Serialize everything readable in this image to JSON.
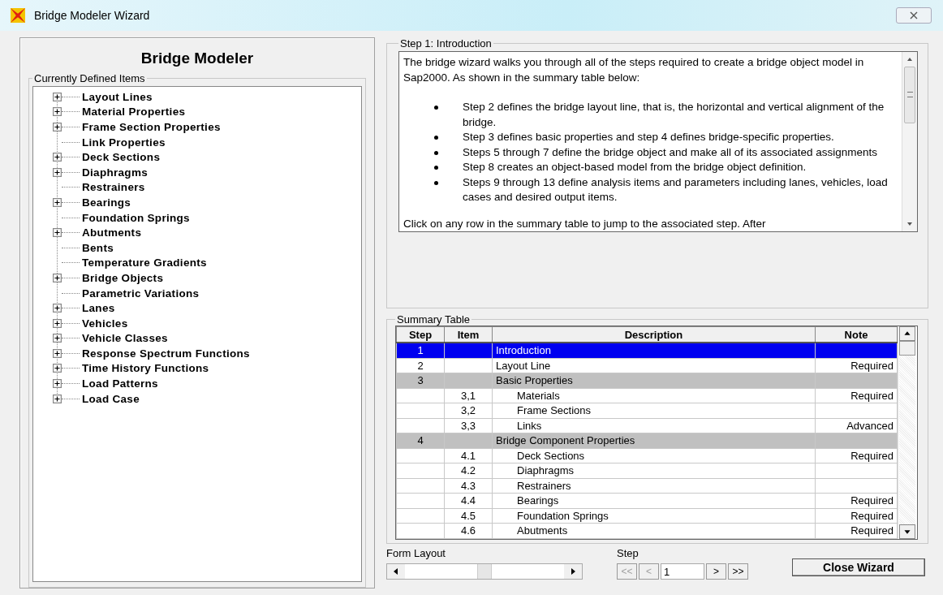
{
  "window": {
    "title": "Bridge Modeler Wizard"
  },
  "heading": "Bridge Modeler",
  "tree": {
    "label": "Currently Defined Items",
    "items": [
      {
        "label": "Layout Lines",
        "has_children": true
      },
      {
        "label": "Material Properties",
        "has_children": true
      },
      {
        "label": "Frame Section Properties",
        "has_children": true
      },
      {
        "label": "Link Properties",
        "has_children": false
      },
      {
        "label": "Deck Sections",
        "has_children": true
      },
      {
        "label": "Diaphragms",
        "has_children": true
      },
      {
        "label": "Restrainers",
        "has_children": false
      },
      {
        "label": "Bearings",
        "has_children": true
      },
      {
        "label": "Foundation Springs",
        "has_children": false
      },
      {
        "label": "Abutments",
        "has_children": true
      },
      {
        "label": "Bents",
        "has_children": false
      },
      {
        "label": "Temperature Gradients",
        "has_children": false
      },
      {
        "label": "Bridge Objects",
        "has_children": true
      },
      {
        "label": "Parametric Variations",
        "has_children": false
      },
      {
        "label": "Lanes",
        "has_children": true
      },
      {
        "label": "Vehicles",
        "has_children": true
      },
      {
        "label": "Vehicle Classes",
        "has_children": true
      },
      {
        "label": "Response Spectrum Functions",
        "has_children": true
      },
      {
        "label": "Time History Functions",
        "has_children": true
      },
      {
        "label": "Load Patterns",
        "has_children": true
      },
      {
        "label": "Load Case",
        "has_children": true
      }
    ]
  },
  "step_panel": {
    "label": "Step 1:  Introduction",
    "intro": "The bridge wizard walks you through all of the steps required to create a bridge object model in Sap2000. As shown in the summary table below:",
    "bullets": [
      "Step 2 defines the bridge layout line, that is, the horizontal and vertical alignment of the bridge.",
      "Step 3 defines basic properties and step 4 defines bridge-specific properties.",
      "Steps 5 through 7 define the bridge object and make all of its associated assignments",
      "Step 8 creates an object-based model from the bridge object definition.",
      "Steps 9 through 13 define analysis items and parameters including lanes, vehicles, load cases and desired output items."
    ],
    "outro": "Click on any row in the summary table to jump to the associated step. After"
  },
  "summary": {
    "label": "Summary Table",
    "columns": [
      "Step",
      "Item",
      "Description",
      "Note"
    ],
    "rows": [
      {
        "kind": "step",
        "step": "1",
        "item": "",
        "description": "Introduction",
        "note": "",
        "selected": true
      },
      {
        "kind": "step",
        "step": "2",
        "item": "",
        "description": "Layout Line",
        "note": "Required",
        "selected": false
      },
      {
        "kind": "group",
        "step": "3",
        "item": "",
        "description": "Basic Properties",
        "note": "",
        "selected": false
      },
      {
        "kind": "sub",
        "step": "",
        "item": "3,1",
        "description": "Materials",
        "note": "Required",
        "selected": false
      },
      {
        "kind": "sub",
        "step": "",
        "item": "3,2",
        "description": "Frame Sections",
        "note": "",
        "selected": false
      },
      {
        "kind": "sub",
        "step": "",
        "item": "3,3",
        "description": "Links",
        "note": "Advanced",
        "selected": false
      },
      {
        "kind": "group",
        "step": "4",
        "item": "",
        "description": "Bridge Component Properties",
        "note": "",
        "selected": false
      },
      {
        "kind": "sub",
        "step": "",
        "item": "4.1",
        "description": "Deck Sections",
        "note": "Required",
        "selected": false
      },
      {
        "kind": "sub",
        "step": "",
        "item": "4.2",
        "description": "Diaphragms",
        "note": "",
        "selected": false
      },
      {
        "kind": "sub",
        "step": "",
        "item": "4.3",
        "description": "Restrainers",
        "note": "",
        "selected": false
      },
      {
        "kind": "sub",
        "step": "",
        "item": "4.4",
        "description": "Bearings",
        "note": "Required",
        "selected": false
      },
      {
        "kind": "sub",
        "step": "",
        "item": "4.5",
        "description": "Foundation Springs",
        "note": "Required",
        "selected": false
      },
      {
        "kind": "sub",
        "step": "",
        "item": "4.6",
        "description": "Abutments",
        "note": "Required",
        "selected": false
      }
    ]
  },
  "form_layout": {
    "label": "Form Layout"
  },
  "step_nav": {
    "label": "Step",
    "first": "<<",
    "prev": "<",
    "value": "1",
    "next": ">",
    "last": ">>",
    "first_disabled": true,
    "prev_disabled": true
  },
  "close_button": "Close Wizard"
}
